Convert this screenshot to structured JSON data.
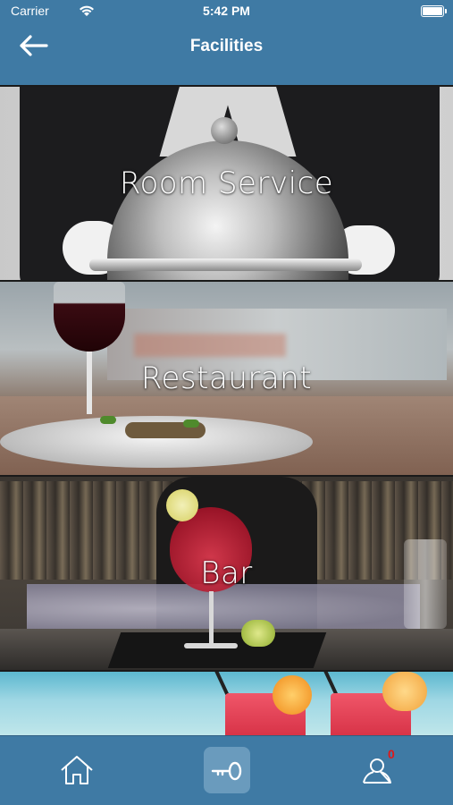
{
  "status_bar": {
    "carrier": "Carrier",
    "time": "5:42 PM",
    "wifi_icon": "wifi-icon",
    "battery_icon": "battery-icon"
  },
  "nav": {
    "title": "Facilities",
    "back_icon": "arrow-left-icon"
  },
  "facilities": [
    {
      "label": "Room Service"
    },
    {
      "label": "Restaurant"
    },
    {
      "label": "Bar"
    },
    {
      "label": ""
    }
  ],
  "tabbar": {
    "items": [
      {
        "icon": "home-icon"
      },
      {
        "icon": "key-icon",
        "active": true
      },
      {
        "icon": "user-icon"
      }
    ],
    "badge_count": "0"
  },
  "colors": {
    "header": "#3f7aa4",
    "tabbar": "#3f7aa4",
    "active_tab": "#6a9bbd",
    "badge": "#e01818"
  }
}
